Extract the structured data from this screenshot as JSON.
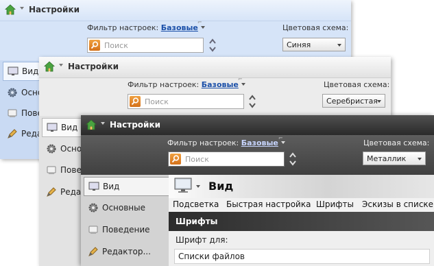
{
  "windows": [
    {
      "title": "Настройки",
      "filter_label": "Фильтр настроек:",
      "filter_value": "Базовые",
      "color_scheme_label": "Цветовая схема:",
      "color_scheme_value": "Синяя",
      "search_placeholder": "Поиск",
      "nav_items": [
        "Вид",
        "Осно",
        "Пове",
        "Реда"
      ]
    },
    {
      "title": "Настройки",
      "filter_label": "Фильтр настроек:",
      "filter_value": "Базовые",
      "color_scheme_label": "Цветовая схема:",
      "color_scheme_value": "Серебристая",
      "search_placeholder": "Поиск",
      "nav_items": [
        "Вид",
        "Осно",
        "Пове",
        "Редак"
      ]
    },
    {
      "title": "Настройки",
      "filter_label": "Фильтр настроек:",
      "filter_value": "Базовые",
      "color_scheme_label": "Цветовая схема:",
      "color_scheme_value": "Металлик",
      "search_placeholder": "Поиск",
      "nav_items": [
        "Вид",
        "Основные",
        "Поведение",
        "Редактор..."
      ],
      "page_title": "Вид",
      "tabs": [
        "Подсветка",
        "Быстрая настройка",
        "Шрифты",
        "Эскизы в списке"
      ],
      "section_title": "Шрифты",
      "font_for_label": "Шрифт для:",
      "font_list_item": "Списки файлов"
    }
  ],
  "icons": {
    "home": "home-icon",
    "search": "search-icon",
    "updown": "up-down-arrows-icon",
    "view": "monitor-icon",
    "basic": "gear-icon",
    "behavior": "behavior-icon",
    "editor": "editor-pencil-icon",
    "pin": "pin-icon"
  },
  "colors": {
    "blue_theme": "#d6e4f8",
    "silver_theme": "#ececec",
    "metallic_title": "#2a2a2a",
    "link": "#1a4fa8",
    "search_icon": "#e08a2a"
  }
}
